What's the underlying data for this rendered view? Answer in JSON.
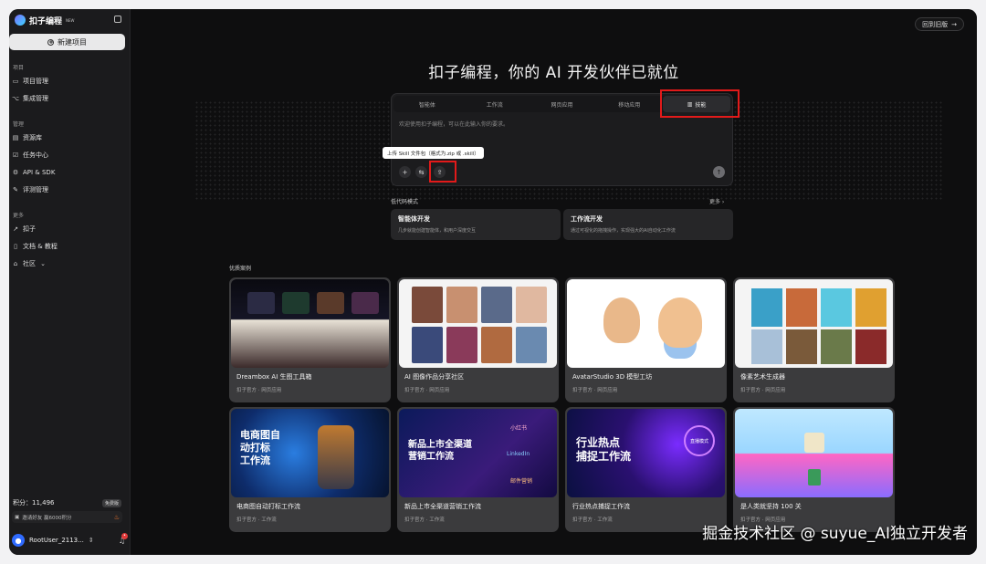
{
  "sidebar": {
    "brand": "扣子编程",
    "badge": "NEW",
    "new_project": "新建项目",
    "sections": {
      "project": "项目",
      "manage": "管理",
      "more": "更多"
    },
    "project_items": [
      "项目管理",
      "集成管理"
    ],
    "manage_items": [
      "资源库",
      "任务中心",
      "API & SDK",
      "评测管理"
    ],
    "more_items": [
      "扣子",
      "文档 & 教程",
      "社区"
    ],
    "points_label": "积分：11,496",
    "subscribe": "免费版",
    "invite": "邀请好友 赢6000积分",
    "username": "RootUser_2113..."
  },
  "header": {
    "old_version": "回到旧版",
    "hero_title": "扣子编程，你的 AI 开发伙伴已就位"
  },
  "composer": {
    "tabs": [
      "智能体",
      "工作流",
      "网页应用",
      "移动应用",
      "技能"
    ],
    "active_tab": 4,
    "placeholder": "欢迎使用扣子编程，可以在此输入你的要求。",
    "tooltip": "上传 Skill 文件包（格式为.zip 或 .skill）"
  },
  "low_code": {
    "title": "低代码模式",
    "more": "更多",
    "cards": [
      {
        "title": "智能体开发",
        "desc": "几步就能创建智能体，和用户深度交互"
      },
      {
        "title": "工作流开发",
        "desc": "通过可视化的拖拽操作，实现强大的AI自动化工作流"
      }
    ]
  },
  "cases": {
    "title": "优质案例",
    "items": [
      {
        "title": "Dreambox AI 生图工具箱",
        "meta": "扣子官方 · 网页应用"
      },
      {
        "title": "AI 图像作品分享社区",
        "meta": "扣子官方 · 网页应用"
      },
      {
        "title": "AvatarStudio 3D 模型工坊",
        "meta": "扣子官方 · 网页应用"
      },
      {
        "title": "像素艺术生成器",
        "meta": "扣子官方 · 网页应用"
      },
      {
        "title": "电商图自动打标工作流",
        "meta": "扣子官方 · 工作流"
      },
      {
        "title": "新品上市全渠道营销工作流",
        "meta": "扣子官方 · 工作流"
      },
      {
        "title": "行业热点捕捉工作流",
        "meta": "扣子官方 · 工作流"
      },
      {
        "title": "是人类就坚持 100 关",
        "meta": "扣子官方 · 网页应用"
      }
    ],
    "posters": {
      "p5": "电商图自\n动打标\n工作流",
      "p6": "新品上市全渠道\n营销工作流",
      "p6_tags": [
        "小红书",
        "LinkedIn",
        "邮件营销"
      ],
      "p7": "行业热点\n捕捉工作流",
      "p7_badge": "直播模式"
    }
  },
  "watermark": "掘金技术社区 @ suyue_AI独立开发者",
  "colors": {
    "accent_red": "#e21a1a",
    "bg": "#0e0e0f",
    "sidebar_bg": "#1b1b1d"
  }
}
